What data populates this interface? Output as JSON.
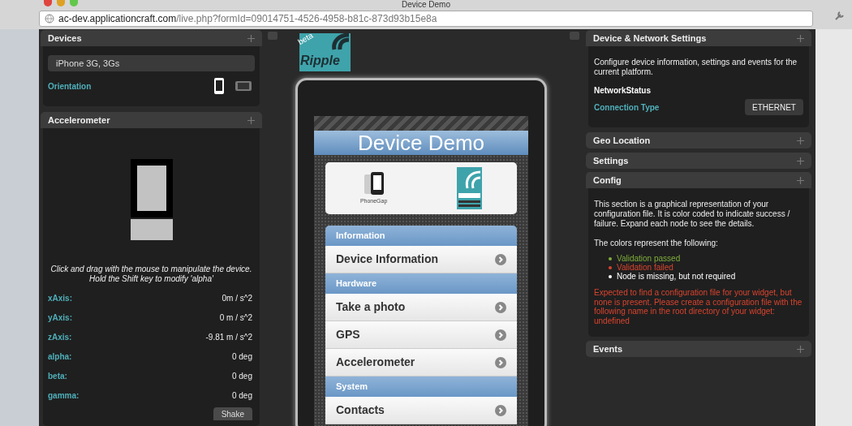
{
  "window": {
    "title": "Device Demo",
    "address_host": "ac-dev.applicationcraft.com",
    "address_path": "/live.php?formId=09014751-4526-4958-b81c-873d93b15e8a"
  },
  "devices": {
    "title": "Devices",
    "device": "iPhone 3G, 3Gs",
    "orientation_label": "Orientation",
    "orientations": [
      {
        "kind": "portrait",
        "selected": true
      },
      {
        "kind": "landscape",
        "selected": false
      }
    ]
  },
  "accelerometer": {
    "title": "Accelerometer",
    "hint": "Click and drag with the mouse to manipulate the device. Hold the Shift key to modify 'alpha'",
    "readings": [
      {
        "label": "xAxis:",
        "value": "0m / s^2"
      },
      {
        "label": "yAxis:",
        "value": "0 m / s^2"
      },
      {
        "label": "zAxis:",
        "value": "-9.81 m / s^2"
      },
      {
        "label": "alpha:",
        "value": "0 deg"
      },
      {
        "label": "beta:",
        "value": "0 deg"
      },
      {
        "label": "gamma:",
        "value": "0 deg"
      }
    ],
    "button": "Shake"
  },
  "logo": {
    "badge": "beta",
    "name": "Ripple"
  },
  "phone": {
    "title": "Device Demo",
    "phonegap": "PhoneGap",
    "menu": [
      {
        "kind": "header",
        "label": "Information"
      },
      {
        "kind": "item",
        "label": "Device Information"
      },
      {
        "kind": "header",
        "label": "Hardware"
      },
      {
        "kind": "item",
        "label": "Take a photo"
      },
      {
        "kind": "item",
        "label": "GPS"
      },
      {
        "kind": "item",
        "label": "Accelerometer"
      },
      {
        "kind": "header",
        "label": "System"
      },
      {
        "kind": "item",
        "label": "Contacts"
      }
    ]
  },
  "network": {
    "title": "Device & Network Settings",
    "description": "Configure device information, settings and events for the current platform.",
    "subheading": "NetworkStatus",
    "field_label": "Connection Type",
    "field_value": "ETHERNET"
  },
  "collapsed_panels": [
    "Geo Location",
    "Settings"
  ],
  "config": {
    "title": "Config",
    "description": "This section is a graphical representation of your configuration file. It is color coded to indicate success / failure. Expand each node to see the details.",
    "legend_intro": "The colors represent the following:",
    "legend": [
      {
        "label": "Validation passed",
        "color": "#7fae3a"
      },
      {
        "label": "Validation failed",
        "color": "#d9442e"
      },
      {
        "label": "Node is missing, but not required",
        "color": "#ffffff"
      }
    ],
    "error": "Expected to find a configuration file for your widget, but none is present. Please create a configuration file with the following name in the root directory of your widget: undefined"
  },
  "events": {
    "title": "Events"
  }
}
